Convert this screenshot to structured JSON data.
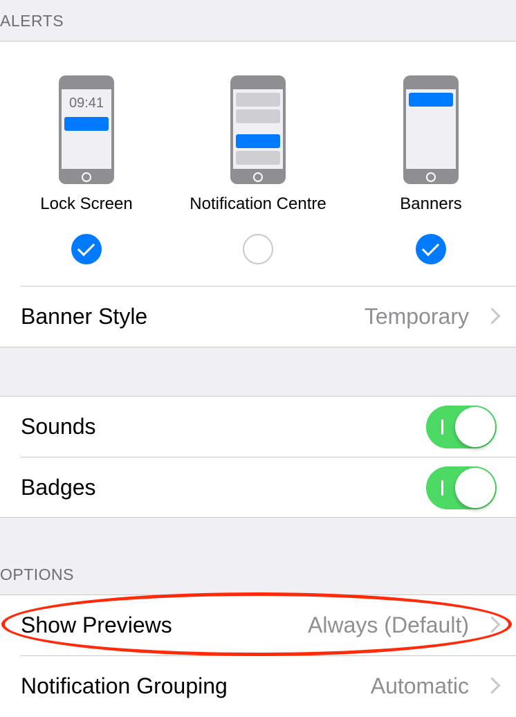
{
  "alerts": {
    "header": "ALERTS",
    "options": [
      {
        "label": "Lock Screen",
        "checked": true,
        "preview_time": "09:41"
      },
      {
        "label": "Notification Centre",
        "checked": false
      },
      {
        "label": "Banners",
        "checked": true
      }
    ],
    "banner_style": {
      "label": "Banner Style",
      "value": "Temporary"
    }
  },
  "toggles": [
    {
      "label": "Sounds",
      "on": true
    },
    {
      "label": "Badges",
      "on": true
    }
  ],
  "options": {
    "header": "OPTIONS",
    "rows": [
      {
        "label": "Show Previews",
        "value": "Always (Default)",
        "highlighted": true
      },
      {
        "label": "Notification Grouping",
        "value": "Automatic"
      }
    ]
  },
  "colors": {
    "accent": "#007aff",
    "toggle_on": "#4cd964",
    "highlight": "#ff2a0a"
  }
}
